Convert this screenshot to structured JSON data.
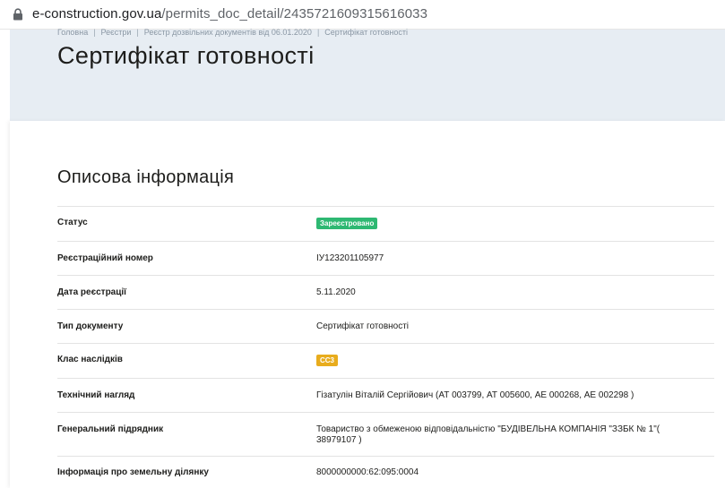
{
  "browser": {
    "url_host": "e-construction.gov.ua",
    "url_path": "/permits_doc_detail/2435721609315616033"
  },
  "breadcrumb": [
    "Головна",
    "Реєстри",
    "Реєстр дозвільних документів від 06.01.2020",
    "Сертифікат готовності"
  ],
  "page_title": "Сертифікат готовності",
  "section_title": "Описова інформація",
  "rows": [
    {
      "label": "Статус",
      "value": "Зареєстровано",
      "badge": "green"
    },
    {
      "label": "Реєстраційний номер",
      "value": "ІУ123201105977"
    },
    {
      "label": "Дата реєстрації",
      "value": "5.11.2020"
    },
    {
      "label": "Тип документу",
      "value": "Сертифікат готовності"
    },
    {
      "label": "Клас наслідків",
      "value": "СС3",
      "badge": "yellow"
    },
    {
      "label": "Технічний нагляд",
      "value": "Гізатулін Віталій Сергійович (АТ 003799, АТ 005600, АЕ 000268, АЕ 002298 )"
    },
    {
      "label": "Генеральний підрядник",
      "value": "Товариство з обмеженою відповідальністю \"БУДІВЕЛЬНА КОМПАНІЯ \"ЗЗБК № 1\"( 38979107 )"
    },
    {
      "label": "Інформація про земельну ділянку",
      "value": "8000000000:62:095:0004"
    }
  ],
  "colors": {
    "hero_bg": "#e7edf3",
    "status_green": "#2eb872",
    "class_yellow": "#e8ac1d"
  },
  "icons": {
    "address_bar": "lock-icon"
  }
}
